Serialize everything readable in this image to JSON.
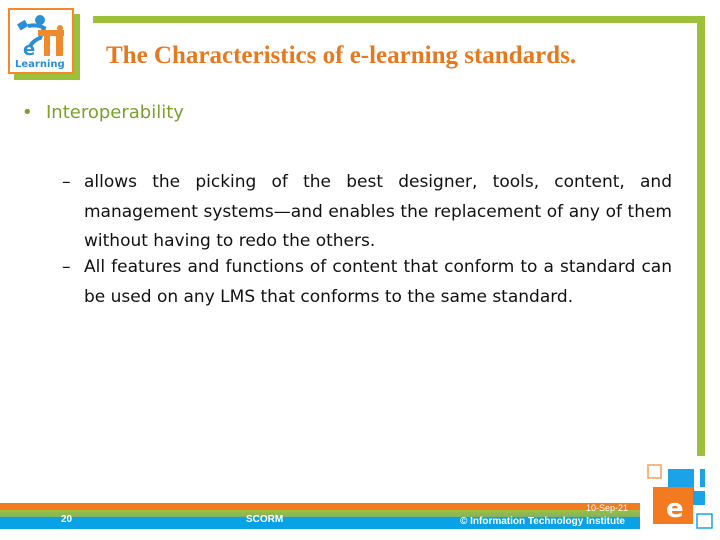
{
  "slide": {
    "title": "The Characteristics of e-learning standards.",
    "bullet": {
      "marker": "•",
      "text": "Interoperability",
      "sub_items": [
        {
          "marker": "–",
          "text": "allows the picking of the best designer, tools, content, and management systems—and enables the replacement of any of them without having to redo the others."
        },
        {
          "marker": "–",
          "text": "All features and functions of content that conform to a standard can be used on any LMS that conforms to the same standard."
        }
      ]
    }
  },
  "logo": {
    "top_left": "ITI eLearning logo",
    "label": "Learning",
    "bottom_right_letter": "e"
  },
  "footer": {
    "slide_number": "20",
    "center_text": "SCORM",
    "date": "10-Sep-21",
    "copyright": "© Information Technology Institute"
  },
  "colors": {
    "title": "#e8781e",
    "bullet": "#7aa12a",
    "frame_green": "#9dc03b",
    "footer_orange": "#f47a1f",
    "footer_blue": "#0aa2e6"
  }
}
